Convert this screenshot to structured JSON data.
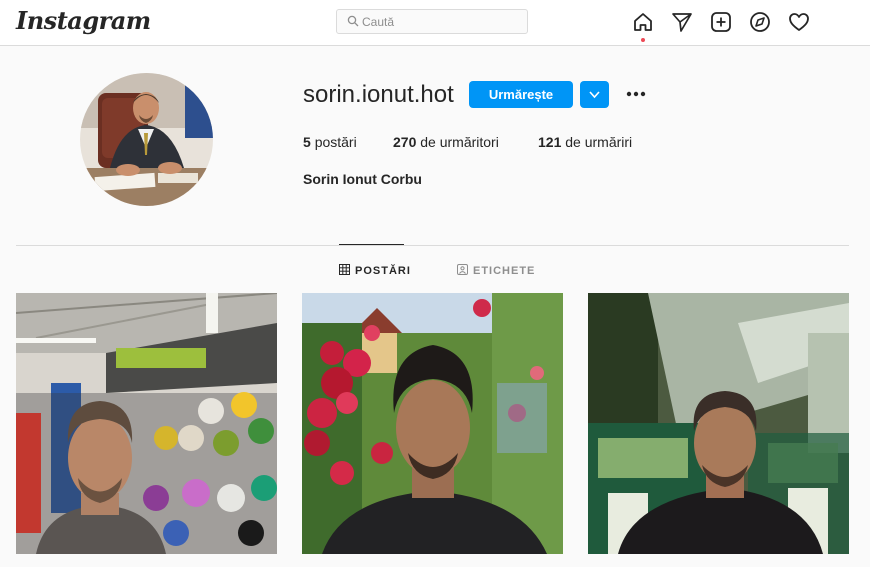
{
  "header": {
    "logo_text": "Instagram",
    "search": {
      "placeholder": "Caută",
      "icon": "search-icon"
    },
    "nav_icons": [
      "home-icon",
      "direct-send-icon",
      "new-post-icon",
      "explore-compass-icon",
      "activity-heart-icon"
    ],
    "notification_color": "#ed4956"
  },
  "profile": {
    "username": "sorin.ionut.hot",
    "follow_label": "Urmărește",
    "dropdown_icon": "chevron-down-icon",
    "options_icon": "more-options-icon",
    "stats": {
      "posts": {
        "count": "5",
        "label": "postări"
      },
      "followers": {
        "count": "270",
        "label": "de urmăritori"
      },
      "following": {
        "count": "121",
        "label": "de urmăriri"
      }
    },
    "full_name": "Sorin Ionut Corbu",
    "accent_color": "#0095f6"
  },
  "tabs": [
    {
      "label": "POSTĂRI",
      "icon": "grid-icon",
      "active": true
    },
    {
      "label": "ETICHETE",
      "icon": "tagged-icon",
      "active": false
    }
  ],
  "posts": [
    {
      "scene": "store-selfie-with-balls"
    },
    {
      "scene": "selfie-with-red-roses"
    },
    {
      "scene": "train-seat-selfie"
    }
  ]
}
